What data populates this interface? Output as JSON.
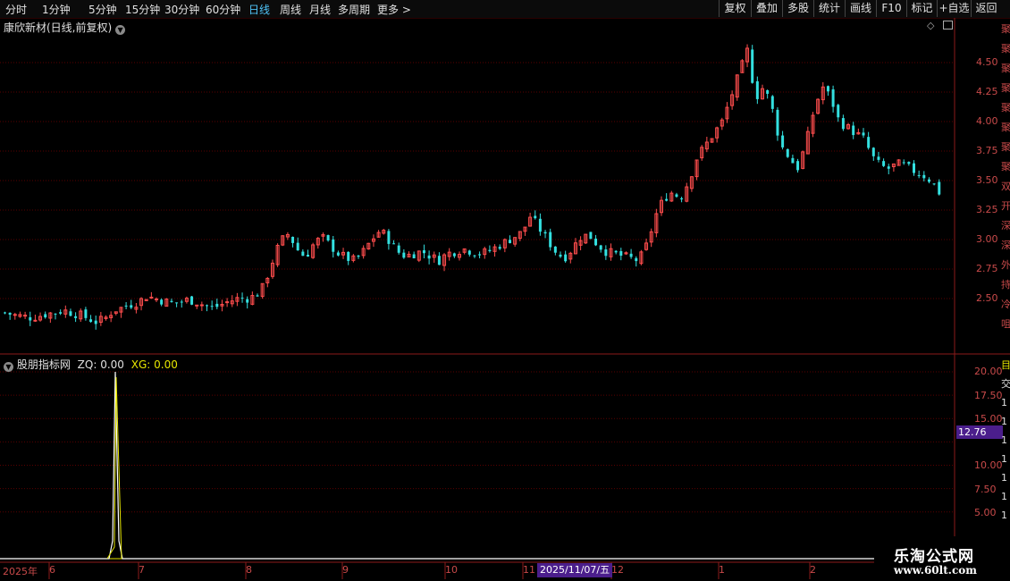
{
  "toolbar": {
    "periods": [
      "分时",
      "1分钟",
      "5分钟",
      "15分钟",
      "30分钟",
      "60分钟",
      "日线",
      "周线",
      "月线",
      "多周期",
      "更多 >"
    ],
    "active_period": "日线",
    "buttons": [
      "复权",
      "叠加",
      "多股",
      "统计",
      "画线",
      "F10",
      "标记",
      "+自选",
      "返回"
    ]
  },
  "main_pane": {
    "title": "康欣新材(日线,前复权)",
    "y_ticks": [
      "4.50",
      "4.25",
      "4.00",
      "3.75",
      "3.50",
      "3.25",
      "3.00",
      "2.75",
      "2.50"
    ]
  },
  "indicator_pane": {
    "name": "股朋指标网",
    "zq_label": "ZQ: 0.00",
    "xg_label": "XG: 0.00",
    "y_ticks": [
      "20.00",
      "17.50",
      "15.00",
      "12.50",
      "10.00",
      "7.50",
      "5.00"
    ],
    "cursor_value": "12.76"
  },
  "date_axis": {
    "labels": [
      "2025年",
      "6",
      "7",
      "8",
      "9",
      "10",
      "11",
      "12",
      "1",
      "2"
    ],
    "cursor_date": "2025/11/07/五"
  },
  "right_strip": [
    "聚",
    "聚",
    "聚",
    "聚",
    "聚",
    "聚",
    "聚",
    "聚",
    "双",
    "开",
    "深",
    "深",
    "外",
    "持",
    "冷",
    "咀"
  ],
  "right_strip_lower": [
    "目",
    "交",
    "1",
    "1",
    "1",
    "1",
    "1",
    "1",
    "1",
    "1"
  ],
  "watermark": {
    "title": "乐淘公式网",
    "url": "www.60lt.com"
  },
  "colors": {
    "up": "#ff4d4d",
    "down": "#33e0e0",
    "grid": "#5a0000",
    "indicator": "#ffffff",
    "baseline": "#e6e600"
  },
  "chart_data": {
    "type": "candlestick",
    "title": "康欣新材(日线,前复权)",
    "ylim": [
      2.25,
      4.75
    ],
    "x_period_labels": [
      "6",
      "7",
      "8",
      "9",
      "10",
      "11",
      "12",
      "1",
      "2"
    ],
    "close_path": [
      2.38,
      2.36,
      2.35,
      2.34,
      2.35,
      2.37,
      2.38,
      2.4,
      2.38,
      2.36,
      2.33,
      2.3,
      2.33,
      2.4,
      2.42,
      2.45,
      2.47,
      2.52,
      2.5,
      2.48,
      2.46,
      2.47,
      2.49,
      2.47,
      2.44,
      2.42,
      2.45,
      2.48,
      2.5,
      2.5,
      2.52,
      2.6,
      2.8,
      2.98,
      3.05,
      2.92,
      2.85,
      2.96,
      3.02,
      2.95,
      2.88,
      2.84,
      2.82,
      2.9,
      3.0,
      3.08,
      3.0,
      2.9,
      2.86,
      2.88,
      2.9,
      2.86,
      2.82,
      2.88,
      2.9,
      2.92,
      2.9,
      2.88,
      2.9,
      2.94,
      2.98,
      3.02,
      3.06,
      3.2,
      3.1,
      3.0,
      2.9,
      2.84,
      2.92,
      3.02,
      3.04,
      2.96,
      2.9,
      2.88,
      2.86,
      2.84,
      2.82,
      2.96,
      3.2,
      3.35,
      3.4,
      3.35,
      3.5,
      3.7,
      3.8,
      3.9,
      4.0,
      4.2,
      4.4,
      4.6,
      4.2,
      4.3,
      4.1,
      3.8,
      3.7,
      3.6,
      3.8,
      4.1,
      4.3,
      4.2,
      4.0,
      3.95,
      3.9,
      3.85,
      3.7,
      3.62,
      3.6,
      3.64,
      3.62,
      3.58,
      3.55,
      3.5,
      3.4
    ],
    "indicator": {
      "series": [
        {
          "name": "ZQ",
          "peak_value": 20.0
        }
      ],
      "ylim": [
        0,
        21
      ]
    }
  }
}
